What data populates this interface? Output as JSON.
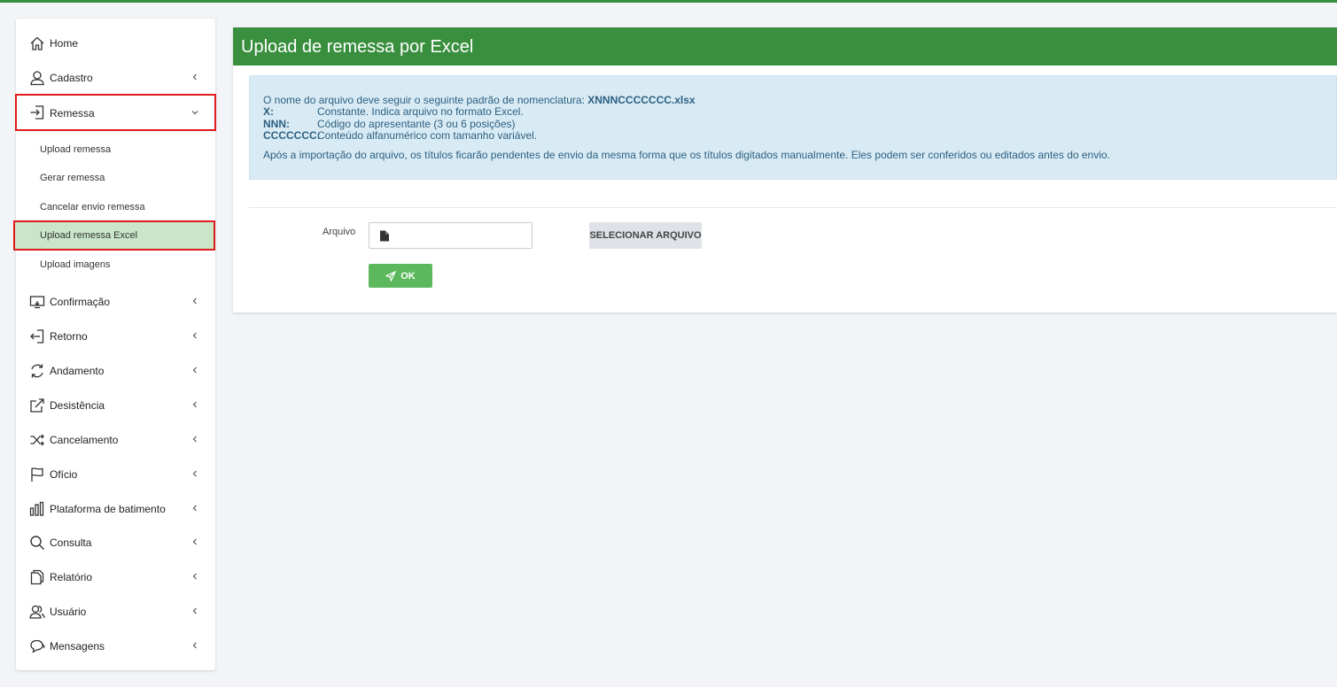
{
  "sidebar": {
    "items": [
      {
        "label": "Home",
        "icon": "home-icon"
      },
      {
        "label": "Cadastro",
        "icon": "user-icon"
      },
      {
        "label": "Remessa",
        "icon": "sign-in-icon"
      },
      {
        "label": "Confirmação",
        "icon": "monitor-icon"
      },
      {
        "label": "Retorno",
        "icon": "sign-out-icon"
      },
      {
        "label": "Andamento",
        "icon": "refresh-icon"
      },
      {
        "label": "Desistência",
        "icon": "share-icon"
      },
      {
        "label": "Cancelamento",
        "icon": "shuffle-icon"
      },
      {
        "label": "Ofício",
        "icon": "flag-icon"
      },
      {
        "label": "Plataforma de batimento",
        "icon": "bar-chart-icon"
      },
      {
        "label": "Consulta",
        "icon": "search-icon"
      },
      {
        "label": "Relatório",
        "icon": "documents-icon"
      },
      {
        "label": "Usuário",
        "icon": "users-icon"
      },
      {
        "label": "Mensagens",
        "icon": "chat-icon"
      }
    ],
    "remessa_sub": [
      {
        "label": "Upload remessa"
      },
      {
        "label": "Gerar remessa"
      },
      {
        "label": "Cancelar envio remessa"
      },
      {
        "label": "Upload remessa Excel"
      },
      {
        "label": "Upload imagens"
      }
    ]
  },
  "main": {
    "title": "Upload de remessa por Excel",
    "info": {
      "intro": "O nome do arquivo deve seguir o seguinte padrão de nomenclatura: ",
      "pattern": "XNNNCCCCCCC.xlsx",
      "rows": [
        {
          "key": "X:",
          "value": "Constante. Indica arquivo no formato Excel."
        },
        {
          "key": "NNN:",
          "value": "Código do apresentante (3 ou 6 posições)"
        },
        {
          "key": "CCCCCCC:",
          "value": "Conteúdo alfanumérico com tamanho variável."
        }
      ],
      "note": "Após a importação do arquivo, os títulos ficarão pendentes de envio da mesma forma que os títulos digitados manualmente. Eles podem ser conferidos ou editados antes do envio."
    },
    "form": {
      "file_label": "Arquivo",
      "file_value": "",
      "select_label": "SELECIONAR ARQUIVO",
      "ok_label": "OK"
    }
  },
  "colors": {
    "header_green": "#3a8f3e",
    "ok_green": "#5cb85c",
    "info_bg": "#d8ebf5",
    "highlight_red": "#e01b1b",
    "selected_bg": "#c9e6c9"
  }
}
